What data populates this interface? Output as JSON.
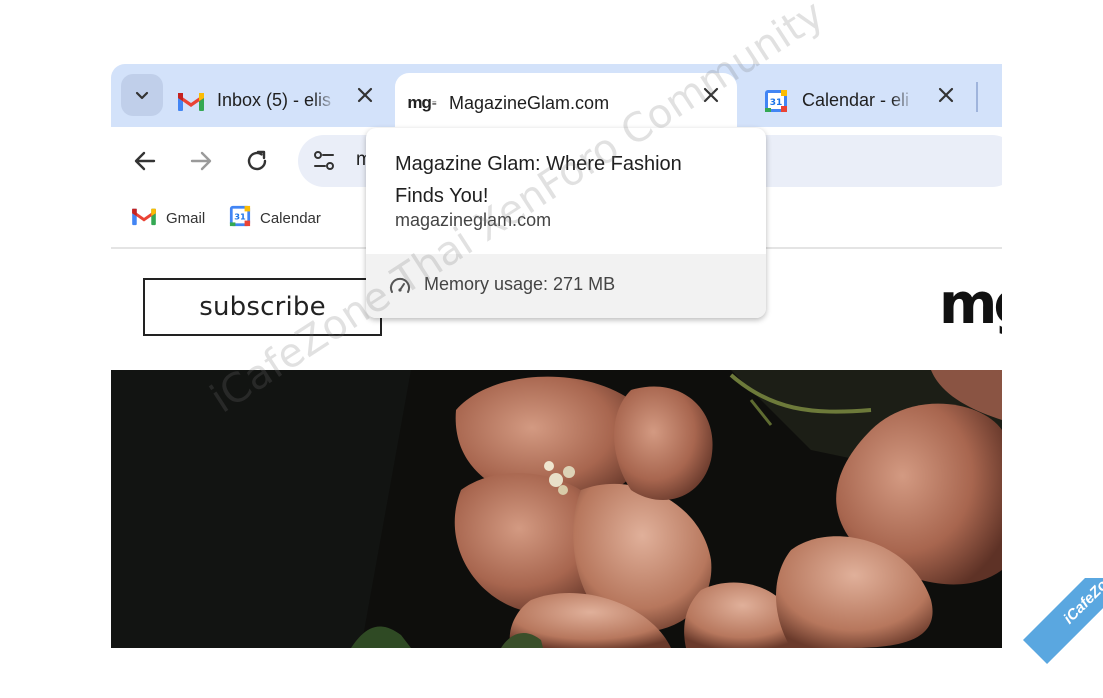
{
  "tabs": [
    {
      "title": "Inbox (5) - elis",
      "icon": "gmail-icon",
      "active": false
    },
    {
      "title": "MagazineGlam.com",
      "icon": "mg-favicon",
      "favicon_text": "mg",
      "active": true
    },
    {
      "title": "Calendar - eli",
      "icon": "calendar-icon",
      "calendar_day": "31",
      "active": false
    }
  ],
  "omnibox": {
    "text": "m"
  },
  "bookmarks": [
    {
      "label": "Gmail",
      "icon": "gmail-icon"
    },
    {
      "label": "Calendar",
      "icon": "calendar-icon",
      "calendar_day": "31"
    }
  ],
  "page": {
    "subscribe_label": "subscribe",
    "logo_text": "mg",
    "hero": "photo of pink bougainvillea flowers on dark background"
  },
  "hovercard": {
    "title": "Magazine Glam: Where Fashion Finds You!",
    "domain": "magazineglam.com",
    "memory": "Memory usage: 271 MB"
  },
  "watermark": {
    "text": "iCafeZone Thai XenForo Community",
    "badge": "iCafeZone"
  },
  "colors": {
    "tabstrip": "#d3e2fa",
    "omnibox": "#eaeef8",
    "badge": "#5aa7e0"
  }
}
